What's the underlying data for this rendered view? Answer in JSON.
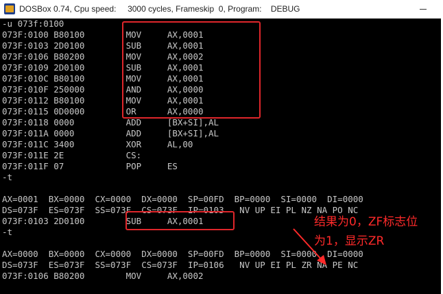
{
  "window": {
    "title": "DOSBox 0.74, Cpu speed:     3000 cycles, Frameskip  0, Program:    DEBUG"
  },
  "console": {
    "lines": [
      "-u 073f:0100",
      "073F:0100 B80100        MOV     AX,0001",
      "073F:0103 2D0100        SUB     AX,0001",
      "073F:0106 B80200        MOV     AX,0002",
      "073F:0109 2D0100        SUB     AX,0001",
      "073F:010C B80100        MOV     AX,0001",
      "073F:010F 250000        AND     AX,0000",
      "073F:0112 B80100        MOV     AX,0001",
      "073F:0115 0D0000        OR      AX,0000",
      "073F:0118 0000          ADD     [BX+SI],AL",
      "073F:011A 0000          ADD     [BX+SI],AL",
      "073F:011C 3400          XOR     AL,00",
      "073F:011E 2E            CS:",
      "073F:011F 07            POP     ES",
      "-t",
      "",
      "AX=0001  BX=0000  CX=0000  DX=0000  SP=00FD  BP=0000  SI=0000  DI=0000",
      "DS=073F  ES=073F  SS=073F  CS=073F  IP=0103   NV UP EI PL NZ NA PO NC",
      "073F:0103 2D0100        SUB     AX,0001",
      "-t",
      "",
      "AX=0000  BX=0000  CX=0000  DX=0000  SP=00FD  BP=0000  SI=0000  DI=0000",
      "DS=073F  ES=073F  SS=073F  CS=073F  IP=0106   NV UP EI PL ZR NA PE NC",
      "073F:0106 B80200        MOV     AX,0002"
    ]
  },
  "annotation": {
    "line1": "结果为0，ZF标志位",
    "line2": "为1，显示ZR"
  },
  "colors": {
    "console_bg": "#000000",
    "console_text": "#c8c8c8",
    "highlight": "#e0262b"
  }
}
